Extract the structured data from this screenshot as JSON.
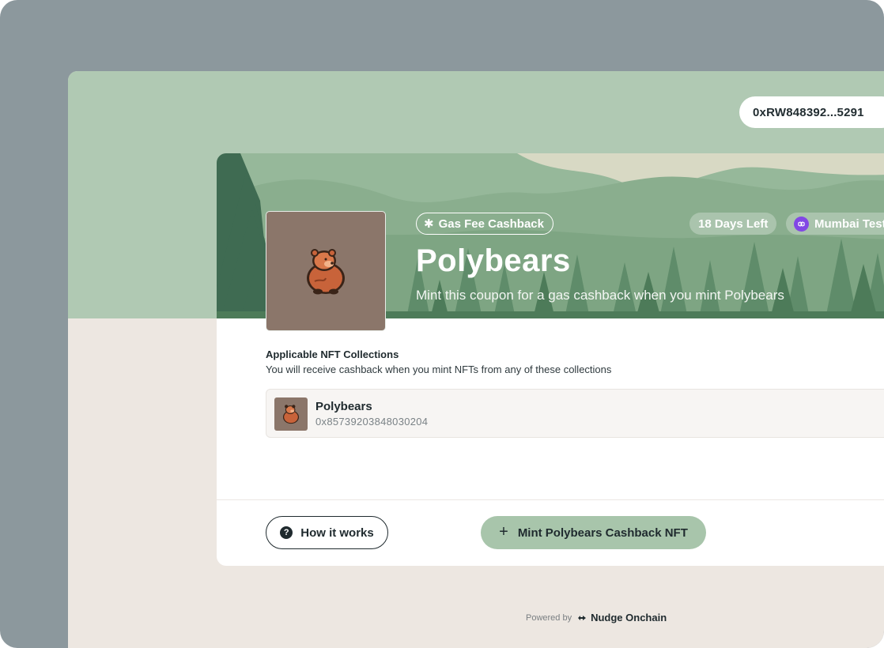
{
  "wallet": {
    "address": "0xRW848392...5291"
  },
  "coupon": {
    "tag": "Gas Fee Cashback",
    "days_left": "18 Days Left",
    "network": "Mumbai Testnet",
    "title": "Polybears",
    "subtitle": "Mint this coupon for a gas cashback when you mint Polybears"
  },
  "collections": {
    "title": "Applicable NFT Collections",
    "description": "You will receive cashback when you mint NFTs from any of these collections",
    "items": [
      {
        "name": "Polybears",
        "address": "0x85739203848030204"
      }
    ]
  },
  "actions": {
    "how_it_works": "How it works",
    "mint": "Mint Polybears Cashback NFT"
  },
  "footer": {
    "powered_by": "Powered by",
    "brand": "Nudge Onchain"
  },
  "icons": {
    "cashback": "asterisk-icon",
    "network": "polygon-icon",
    "help": "question-circle-icon",
    "mint": "plus-icon",
    "brand": "nudge-logo-icon"
  },
  "colors": {
    "frame": "#8c989d",
    "header_green": "#b0c9b3",
    "banner_green": "#8fb292",
    "forest_dark": "#3f6b52",
    "mint_button": "#a8c5ab",
    "page_beige": "#ede7e1",
    "polygon_purple": "#8247e5"
  }
}
